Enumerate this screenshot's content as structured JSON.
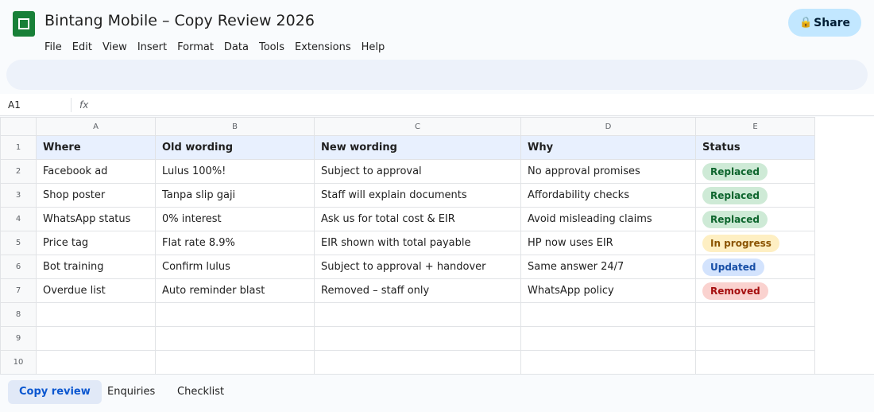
{
  "app": {
    "title": "Bintang Mobile – Copy Review 2026",
    "menu": [
      "File",
      "Edit",
      "View",
      "Insert",
      "Format",
      "Data",
      "Tools",
      "Extensions",
      "Help"
    ],
    "share_icon": "lock-icon",
    "share_label": "Share"
  },
  "formula_bar": {
    "cell_ref": "A1",
    "fx_label": "fx"
  },
  "sheet": {
    "columns": [
      "A",
      "B",
      "C",
      "D",
      "E"
    ],
    "row_numbers": [
      "1",
      "2",
      "3",
      "4",
      "5",
      "6",
      "7",
      "8",
      "9",
      "10"
    ],
    "header": [
      "Where",
      "Old wording",
      "New wording",
      "Why",
      "Status"
    ],
    "rows": [
      [
        "Facebook ad",
        "Lulus 100%!",
        "Subject to approval",
        "No approval promises",
        "Replaced"
      ],
      [
        "Shop poster",
        "Tanpa slip gaji",
        "Staff will explain documents",
        "Affordability checks",
        "Replaced"
      ],
      [
        "WhatsApp status",
        "0% interest",
        "Ask us for total cost & EIR",
        "Avoid misleading claims",
        "Replaced"
      ],
      [
        "Price tag",
        "Flat rate 8.9%",
        "EIR shown with total payable",
        "HP now uses EIR",
        "In progress"
      ],
      [
        "Bot training",
        "Confirm lulus",
        "Subject to approval + handover",
        "Same answer 24/7",
        "Updated"
      ],
      [
        "Overdue list",
        "Auto reminder blast",
        "Removed – staff only",
        "WhatsApp policy",
        "Removed"
      ]
    ],
    "status_colors": {
      "Replaced": "#ceead6",
      "In progress": "#feefc3",
      "Updated": "#d3e3fd",
      "Removed": "#fad2cf"
    }
  },
  "tabs": [
    "Copy review",
    "Enquiries",
    "Checklist"
  ],
  "active_tab": "Copy review"
}
